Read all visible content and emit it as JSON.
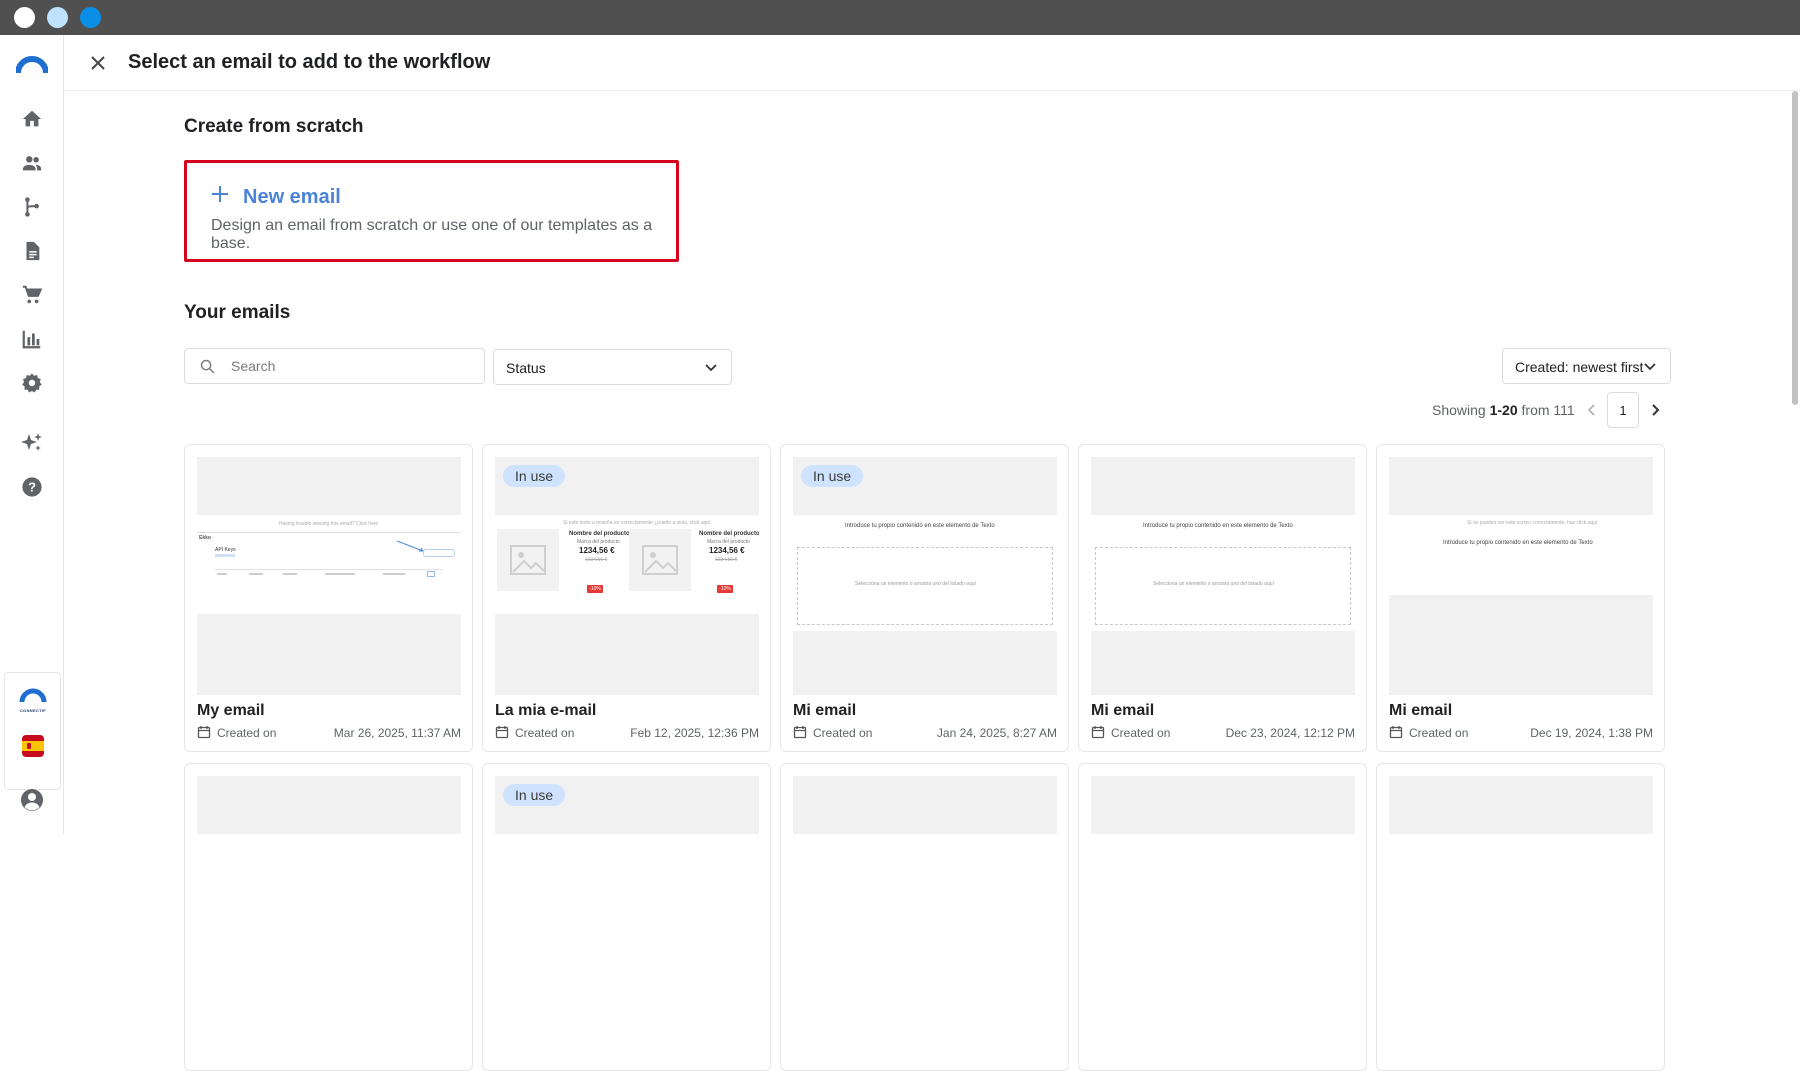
{
  "header": {
    "title": "Select an email to add to the workflow"
  },
  "sidebar": {
    "items": [
      "home-icon",
      "contacts-icon",
      "workflow-icon",
      "content-icon",
      "cart-icon",
      "analytics-icon",
      "settings-icon",
      "ai-sparkle-icon",
      "help-icon"
    ],
    "brand_text": "CONNECTIF",
    "flag": "es",
    "account": "account-icon"
  },
  "scratch": {
    "title": "Create from scratch",
    "new_label": "New email",
    "new_desc": "Design an email from scratch or use one of our templates as a base."
  },
  "emails": {
    "title": "Your emails",
    "search_placeholder": "Search",
    "status_label": "Status",
    "sort_label": "Created: newest first",
    "showing_prefix": "Showing",
    "showing_range": "1-20",
    "showing_suffix": "from 111",
    "page": "1",
    "created_label": "Created on",
    "in_use_label": "In use",
    "cards": [
      {
        "name": "My email",
        "date": "Mar 26, 2025, 11:37 AM",
        "in_use": false
      },
      {
        "name": "La mia e-mail",
        "date": "Feb 12, 2025, 12:36 PM",
        "in_use": true
      },
      {
        "name": "Mi email",
        "date": "Jan 24, 2025, 8:27 AM",
        "in_use": true
      },
      {
        "name": "Mi email",
        "date": "Dec 23, 2024, 12:12 PM",
        "in_use": false
      },
      {
        "name": "Mi email",
        "date": "Dec 19, 2024, 1:38 PM",
        "in_use": false
      }
    ],
    "row2_in_use": [
      false,
      true,
      false,
      false,
      false
    ]
  },
  "previews": {
    "card1_top": "Having trouble viewing this email? Click here",
    "card1_brand": "Ekko",
    "card1_heading": "API Keys",
    "card2_top": "Si este texto u enseña en correctamente ¿puedo a vista, click aquí",
    "product_name": "Nombre del producto",
    "product_brand": "Marca del producto",
    "product_price": "1234,56 €",
    "product_old_price": "1234,56 €",
    "product_discount": "-10%",
    "card3_text": "Introduce tu propio contenido en este elemento de Texto",
    "card3_drop": "Selecciona un elemento o arrastra uno del listado aquí",
    "card4_text": "Introduce tu propio contenido en este elemento de Texto",
    "card4_drop": "Selecciona un elemento o arrastra uno del listado aquí",
    "card5_top": "Si no puedes ver este correo correctamente, haz click aquí",
    "card5_text": "Introduce tu propio contenido en este elemento de Texto"
  },
  "colors": {
    "accent": "#4a83d8",
    "highlight_border": "#d6001c",
    "badge": "#cfe3ff",
    "titlebar": "#505050"
  }
}
